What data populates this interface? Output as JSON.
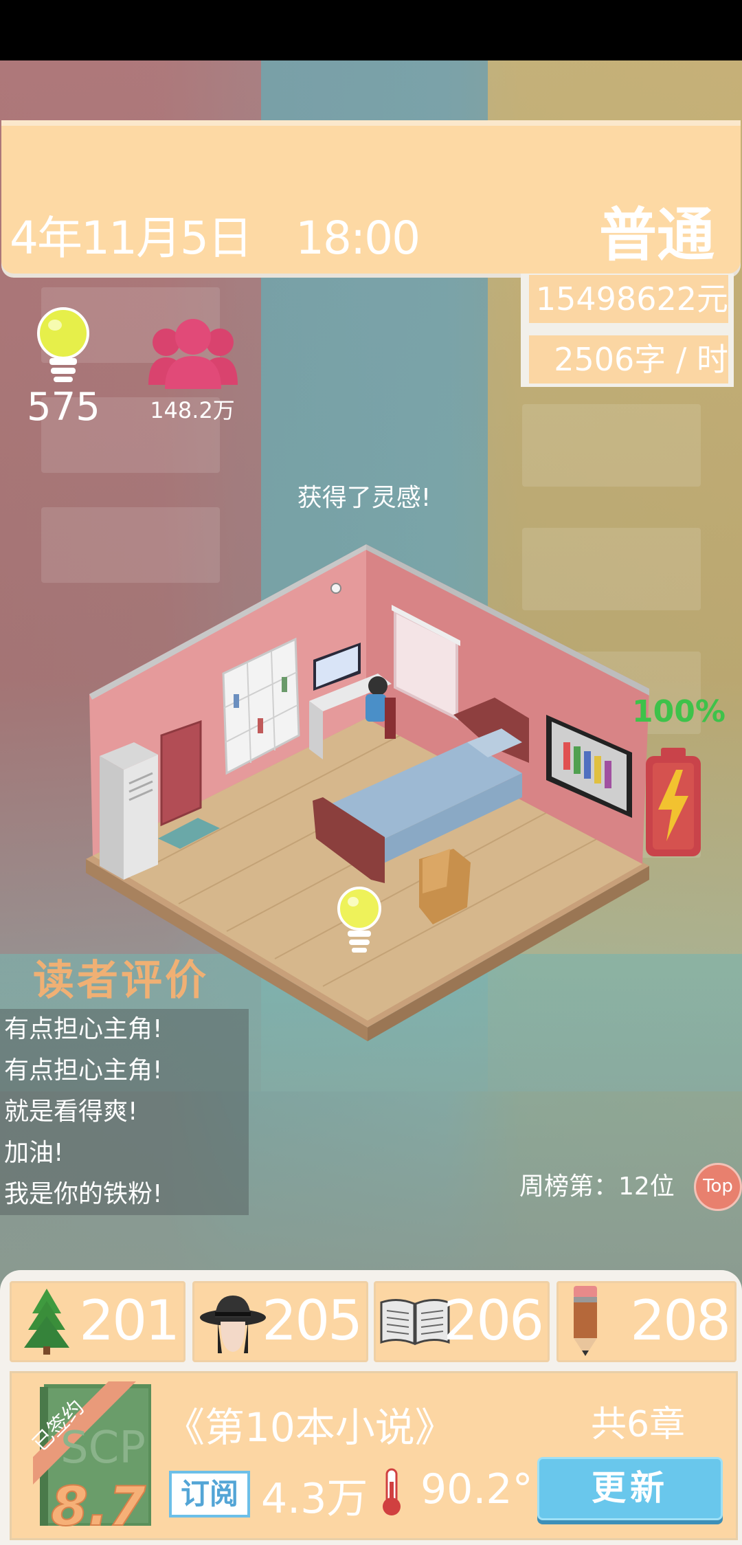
{
  "header": {
    "date_time": "4年11月5日　18:00",
    "mode": "普通"
  },
  "finance": {
    "money": "15498622元",
    "speed": "2506字 / 时"
  },
  "resources": {
    "inspiration": "575",
    "fans": "148.2万"
  },
  "room": {
    "hint": "获得了灵感!",
    "battery": "100%",
    "battery_level": 1.0
  },
  "reviews": {
    "title": "读者评价",
    "items": [
      "有点担心主角!",
      "有点担心主角!",
      "就是看得爽!",
      "加油!",
      "我是你的铁粉!"
    ]
  },
  "ranking": {
    "label": "周榜第：12位",
    "top_button": "Top"
  },
  "stats": [
    {
      "icon": "tree-icon",
      "value": "201"
    },
    {
      "icon": "detective-icon",
      "value": "205"
    },
    {
      "icon": "book-icon",
      "value": "206"
    },
    {
      "icon": "pencil-icon",
      "value": "208"
    }
  ],
  "novel": {
    "signed_ribbon": "已签约",
    "cover_text": "SCP",
    "score": "8.7",
    "title": "《第10本小说》",
    "chapters": "共6章",
    "subscribe_label": "订阅",
    "subscribe_count": "4.3万",
    "heat": "90.2°",
    "update_button": "更新"
  },
  "colors": {
    "panel": "#fdd9a4",
    "battery_text": "#3ec24a",
    "update_button": "#69c7ec"
  }
}
